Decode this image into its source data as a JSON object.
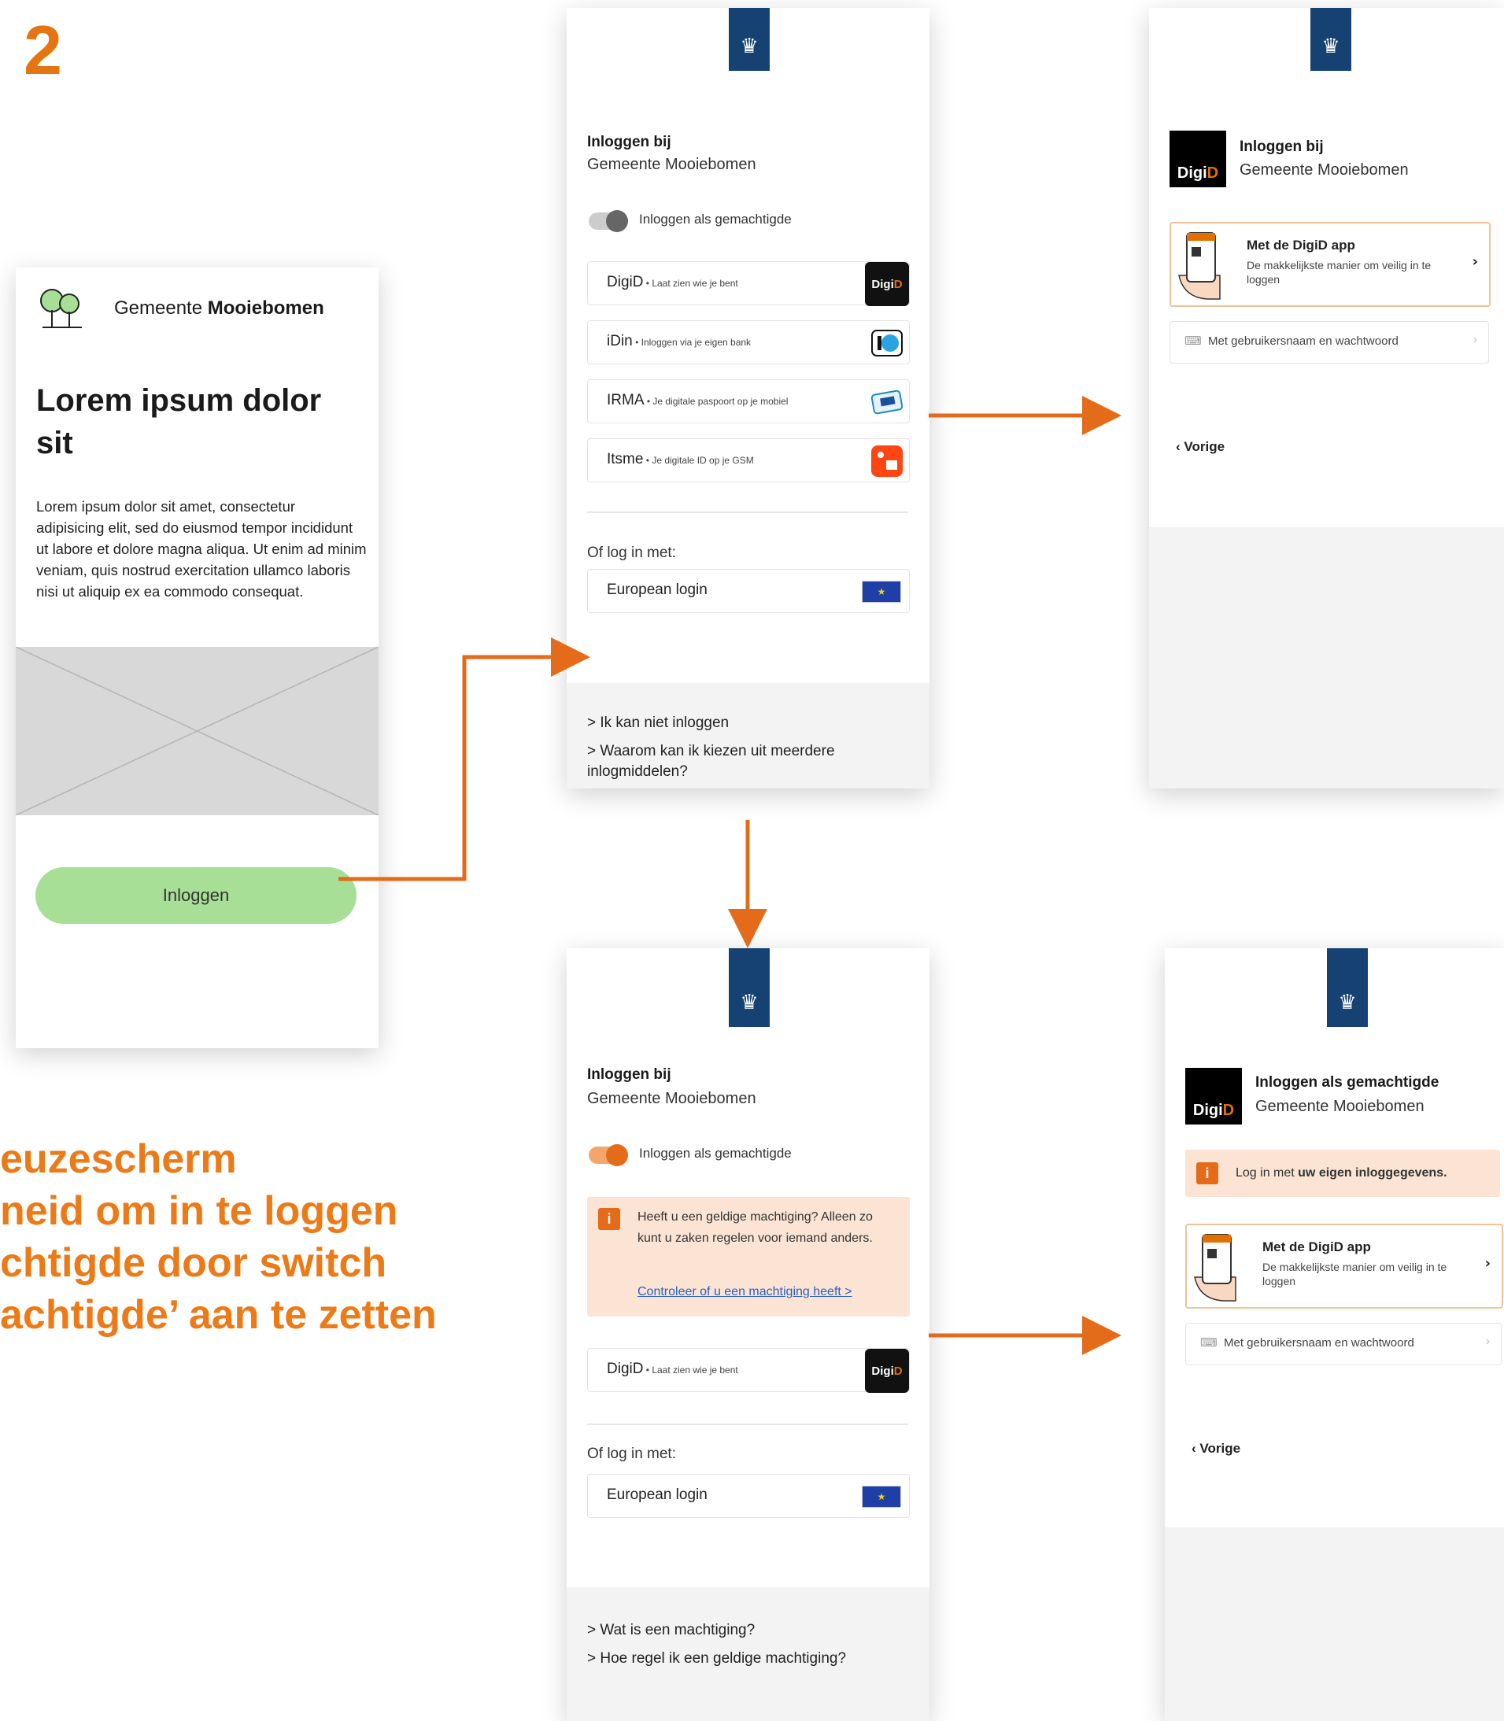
{
  "step_number": "2",
  "caption": {
    "line1": "euzescherm",
    "line2": "neid om in te loggen",
    "line3": "chtigde door switch",
    "line4": "achtigde’ aan te zetten"
  },
  "colors": {
    "accent": "#e46b1a",
    "crest_blue": "#154273",
    "login_button": "#a6df95"
  },
  "site": {
    "title_prefix": "Gemeente ",
    "title_bold": "Mooiebomen",
    "heading": "Lorem ipsum dolor sit",
    "body": "Lorem ipsum dolor sit amet, consectetur adipisicing elit, sed do eiusmod tempor incididunt ut labore et dolore magna aliqua. Ut enim ad minim veniam, quis nostrud exercitation ullamco laboris nisi ut aliquip ex ea commodo consequat.",
    "login_button": "Inloggen",
    "logo_icon": "trees-icon"
  },
  "choice_screen": {
    "title": "Inloggen bij",
    "subtitle": "Gemeente Mooiebomen",
    "toggle_label": "Inloggen als gemachtigde",
    "options": [
      {
        "name": "DigiD",
        "desc": " • Laat zien wie je bent",
        "logo": "digid-logo"
      },
      {
        "name": "iDin",
        "desc": " • Inloggen via je eigen bank",
        "logo": "idin-logo"
      },
      {
        "name": "IRMA",
        "desc": " • Je digitale paspoort op je mobiel",
        "logo": "irma-logo"
      },
      {
        "name": "Itsme",
        "desc": " • Je digitale ID op je GSM",
        "logo": "itsme-logo"
      }
    ],
    "or_label": "Of log in met:",
    "european_login": "European login",
    "footer_links": [
      "> Ik kan niet inloggen",
      "> Waarom kan ik kiezen uit meerdere inlogmiddelen?"
    ]
  },
  "choice_screen_delegate": {
    "title": "Inloggen bij",
    "subtitle": "Gemeente Mooiebomen",
    "toggle_label": "Inloggen als gemachtigde",
    "alert_text": "Heeft u een geldige machtiging? Alleen zo kunt u zaken regelen voor iemand anders.",
    "alert_link": "Controleer of u een machtiging heeft >",
    "option_name": "DigiD",
    "option_desc": " • Laat zien wie je bent",
    "or_label": "Of log in met:",
    "european_login": "European login",
    "footer_links": [
      "> Wat is een machtiging?",
      "> Hoe regel ik een geldige machtiging?"
    ]
  },
  "digid_screen": {
    "title": "Inloggen bij",
    "subtitle": "Gemeente Mooiebomen",
    "app_title": "Met de DigiD app",
    "app_sub": "De makkelijkste manier om veilig in te loggen",
    "password_option": "Met gebruikersnaam en wachtwoord",
    "back": "Vorige"
  },
  "digid_screen_delegate": {
    "title": "Inloggen als gemachtigde",
    "subtitle": "Gemeente Mooiebomen",
    "alert_prefix": "Log in met ",
    "alert_bold": "uw eigen inloggegevens.",
    "app_title": "Met de DigiD app",
    "app_sub": "De makkelijkste manier om veilig in te loggen",
    "password_option": "Met gebruikersnaam en wachtwoord",
    "back": "Vorige"
  },
  "badge": {
    "digi": "Digi",
    "d": "D"
  }
}
